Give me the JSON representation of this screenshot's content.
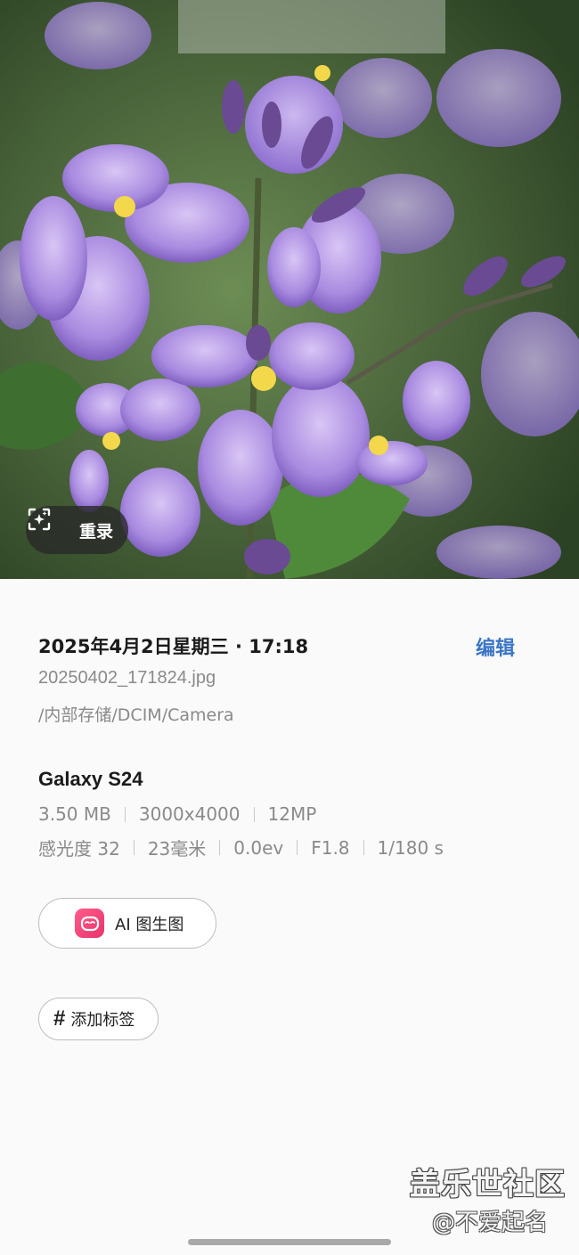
{
  "photo": {
    "remaster_label": "重录",
    "icon": "sparkle-frame-icon"
  },
  "details": {
    "date": "2025年4月2日星期三 · 17:18",
    "edit_label": "编辑",
    "filename": "20250402_171824.jpg",
    "path": "/内部存储/DCIM/Camera",
    "device": "Galaxy S24",
    "file_info": [
      "3.50 MB",
      "3000x4000",
      "12MP"
    ],
    "exif": [
      "感光度 32",
      "23毫米",
      "0.0ev",
      "F1.8",
      "1/180 s"
    ],
    "ai_button_label": "AI 图生图",
    "add_tag_label": "添加标签",
    "accent_color": "#3b76c6"
  },
  "watermark": {
    "line1": "盖乐世社区",
    "line2": "@不爱起名"
  }
}
